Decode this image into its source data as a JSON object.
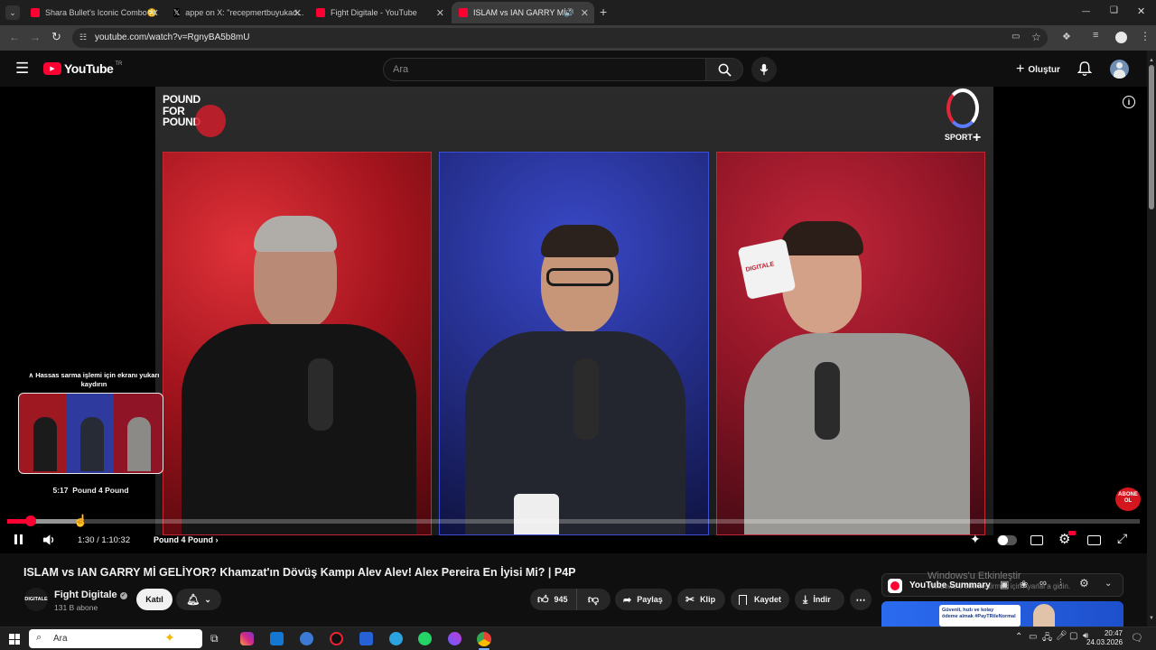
{
  "browser": {
    "tabs": [
      {
        "title": "Shara Bullet's Iconic Combo😳",
        "favicon_color": "#ff0033"
      },
      {
        "title": "appe on X: \"recepmertbuyukad...",
        "favicon_color": "#ffffff"
      },
      {
        "title": "Fight Digitale - YouTube",
        "favicon_color": "#ff0033"
      },
      {
        "title": "ISLAM vs IAN GARRY Mİ GE...",
        "favicon_color": "#ff0033"
      }
    ],
    "new_tab": "+",
    "url": "youtube.com/watch?v=RgnyBA5b8mU",
    "window_controls": {
      "minimize": "—",
      "restore": "❏",
      "close": "✕"
    }
  },
  "yt": {
    "logo_text": "YouTube",
    "region": "TR",
    "search_placeholder": "Ara",
    "create_label": "Oluştur"
  },
  "video": {
    "overlay_logo": "POUND FOR POUND",
    "sport_logo": "SPORT",
    "mug_text": "DIGITALE",
    "scrub_hint": "∧ Hassas sarma işlemi için ekranı yukarı kaydırın",
    "preview_time": "5:17",
    "preview_chapter": "Pound 4 Pound",
    "time_current": "1:30",
    "time_total": "1:10:32",
    "time_sep": "/",
    "chapter": "Pound 4 Pound",
    "subscribe_badge": "ABONE OL",
    "progress_played": 0.021,
    "progress_buffered": 0.063
  },
  "title": "ISLAM vs IAN GARRY Mİ GELİYOR? Khamzat'ın Dövüş Kampı Alev Alev! Alex Pereira En İyisi Mi? | P4P",
  "channel": {
    "name": "Fight Digitale",
    "subscribers": "131 B abone",
    "join": "Katıl",
    "avatar_text": "DIGITALE"
  },
  "actions": {
    "likes": "945",
    "share": "Paylaş",
    "clip": "Klip",
    "save": "Kaydet",
    "download": "İndir"
  },
  "side": {
    "summary": "YouTube Summary",
    "watermark_line1": "Windows'u Etkinleştir",
    "watermark_line2": "Windows'u etkinleştirmek için Ayarlar'a gidin.",
    "ad_line1": "Güvenli, hızlı ve kolay",
    "ad_line2": "ödeme almak #PayTRileNormal"
  },
  "taskbar": {
    "search_placeholder": "Ara",
    "time": "20:47",
    "date": "24.03.2026"
  },
  "colors": {
    "yt_red": "#ff0033",
    "bg": "#0f0f0f",
    "pill": "#272727",
    "panel_red": "#b3121f",
    "panel_blue": "#2d3ab3"
  }
}
